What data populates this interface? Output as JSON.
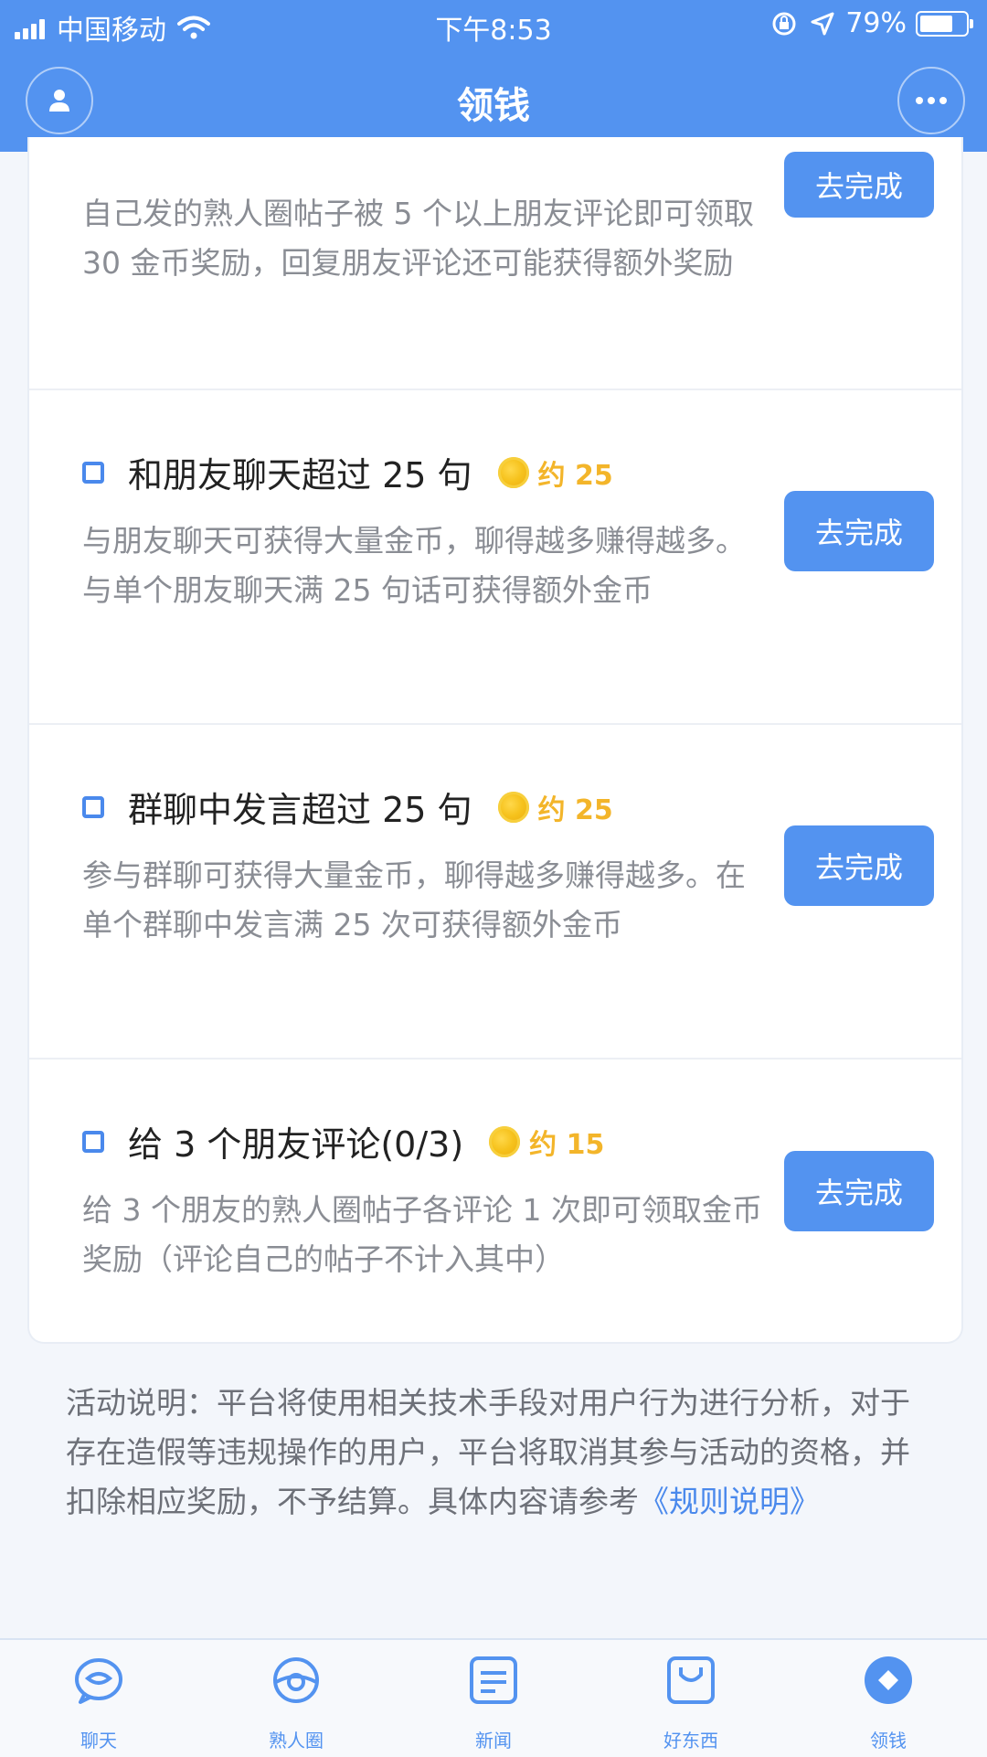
{
  "status_bar": {
    "carrier": "中国移动",
    "time": "下午8:53",
    "battery_percent": "79%",
    "battery_level": 0.79
  },
  "header": {
    "title": "领钱"
  },
  "tasks": [
    {
      "title": "",
      "reward": "",
      "description": "自己发的熟人圈帖子被 5 个以上朋友评论即可领取 30 金币奖励，回复朋友评论还可能获得额外奖励",
      "button": "去完成"
    },
    {
      "title": "和朋友聊天超过 25 句",
      "reward": "约 25",
      "description": "与朋友聊天可获得大量金币，聊得越多赚得越多。与单个朋友聊天满 25 句话可获得额外金币",
      "button": "去完成"
    },
    {
      "title": "群聊中发言超过 25 句",
      "reward": "约 25",
      "description": "参与群聊可获得大量金币，聊得越多赚得越多。在单个群聊中发言满 25 次可获得额外金币",
      "button": "去完成"
    },
    {
      "title": "给 3 个朋友评论(0/3)",
      "reward": "约 15",
      "description": "给 3 个朋友的熟人圈帖子各评论 1 次即可领取金币奖励（评论自己的帖子不计入其中）",
      "button": "去完成"
    }
  ],
  "notice": {
    "text": "活动说明：平台将使用相关技术手段对用户行为进行分析，对于存在造假等违规操作的用户，平台将取消其参与活动的资格，并扣除相应奖励，不予结算。具体内容请参考",
    "link": "《规则说明》"
  },
  "tab_bar": [
    {
      "label": "聊天",
      "icon": "chat-icon"
    },
    {
      "label": "熟人圈",
      "icon": "circle-icon"
    },
    {
      "label": "新闻",
      "icon": "news-icon"
    },
    {
      "label": "好东西",
      "icon": "shopping-bag-icon"
    },
    {
      "label": "领钱",
      "icon": "money-icon",
      "active": true
    }
  ],
  "colors": {
    "primary": "#5393f0",
    "reward": "#f3b52a",
    "link": "#4a89ec"
  }
}
